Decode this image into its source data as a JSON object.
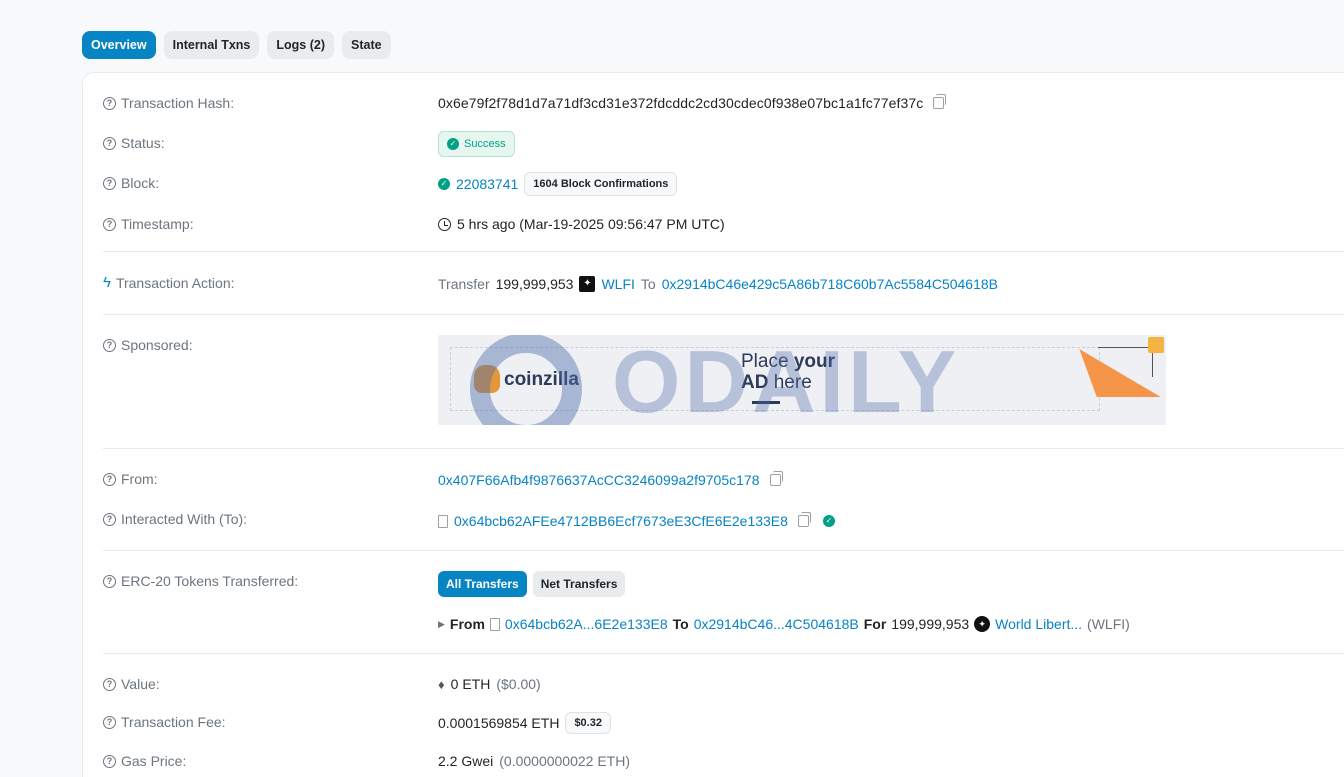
{
  "tabs": [
    {
      "label": "Overview",
      "active": true
    },
    {
      "label": "Internal Txns",
      "active": false
    },
    {
      "label": "Logs (2)",
      "active": false
    },
    {
      "label": "State",
      "active": false
    }
  ],
  "labels": {
    "hash": "Transaction Hash:",
    "status": "Status:",
    "block": "Block:",
    "timestamp": "Timestamp:",
    "action": "Transaction Action:",
    "sponsored": "Sponsored:",
    "from": "From:",
    "interacted": "Interacted With (To):",
    "erc20": "ERC-20 Tokens Transferred:",
    "value": "Value:",
    "fee": "Transaction Fee:",
    "gas_price": "Gas Price:"
  },
  "tx": {
    "hash": "0x6e79f2f78d1d7a71df3cd31e372fdcddc2cd30cdec0f938e07bc1a1fc77ef37c",
    "status": "Success",
    "block_number": "22083741",
    "confirmations": "1604 Block Confirmations",
    "timestamp": "5 hrs ago (Mar-19-2025 09:56:47 PM UTC)",
    "action": {
      "verb": "Transfer",
      "amount": "199,999,953",
      "token": "WLFI",
      "to_word": "To",
      "to_address": "0x2914bC46e429c5A86b718C60b7Ac5584C504618B"
    },
    "from": "0x407F66Afb4f9876637AcCC3246099a2f9705c178",
    "interacted_with": "0x64bcb62AFEe4712BB6Ecf7673eE3CfE6E2e133E8",
    "transfers": {
      "all_label": "All Transfers",
      "net_label": "Net Transfers",
      "from_word": "From",
      "from_short": "0x64bcb62A...6E2e133E8",
      "to_word": "To",
      "to_short": "0x2914bC46...4C504618B",
      "for_word": "For",
      "amount": "199,999,953",
      "token_name": "World Libert...",
      "token_symbol": "(WLFI)"
    },
    "value": {
      "eth": "0 ETH",
      "usd": "($0.00)"
    },
    "fee": {
      "eth": "0.0001569854 ETH",
      "usd": "$0.32"
    },
    "gas_price": {
      "gwei": "2.2 Gwei",
      "eth": "(0.0000000022 ETH)"
    }
  },
  "ad": {
    "brand": "coinzilla",
    "line1_a": "Place ",
    "line1_b": "your",
    "line2_a": "AD",
    "line2_b": " here",
    "watermark": "ODAILY"
  },
  "colors": {
    "accent": "#0784c3",
    "success": "#00a186"
  }
}
